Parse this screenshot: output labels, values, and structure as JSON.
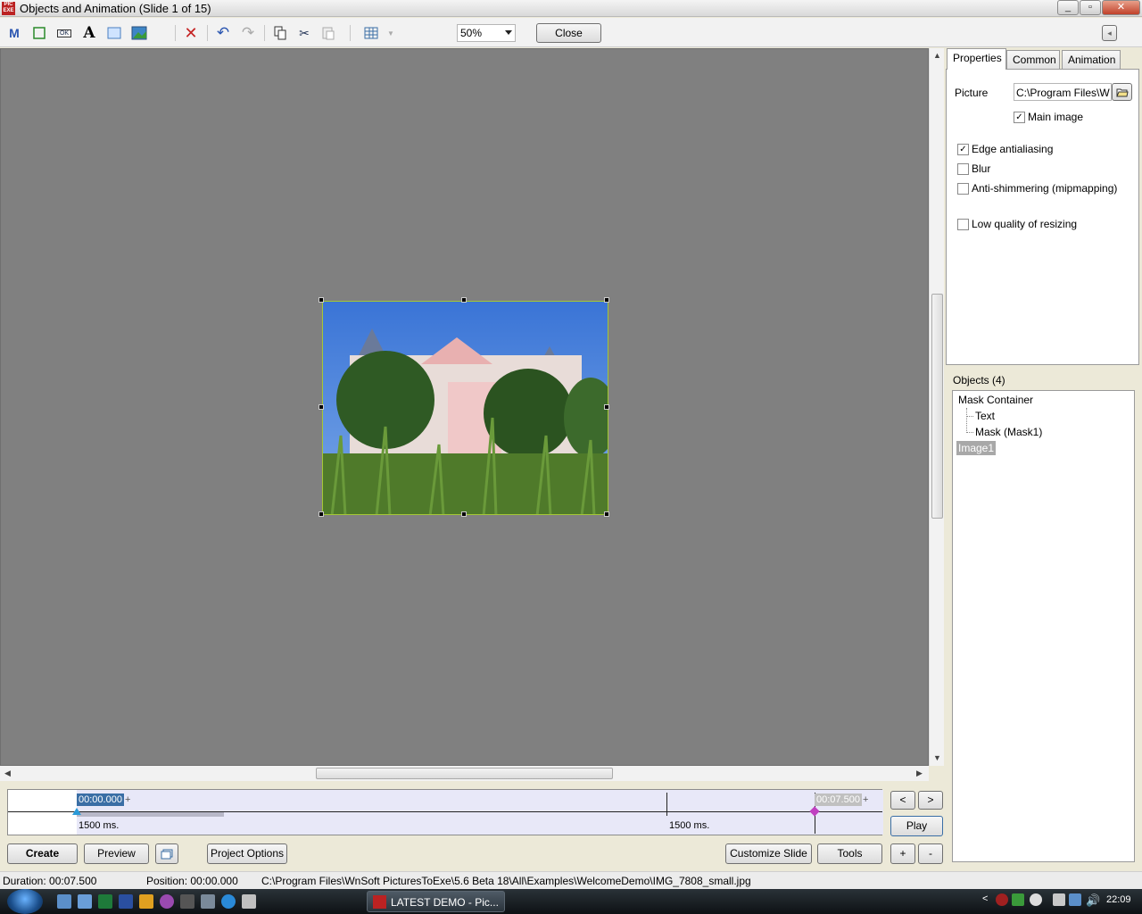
{
  "window": {
    "title": "Objects and Animation  (Slide 1 of 15)",
    "app_icon_text": "PIC EXE"
  },
  "toolbar": {
    "icons": [
      "mask-icon",
      "rectangle-icon",
      "button-icon",
      "text-icon",
      "frame-icon",
      "image-icon",
      "delete-icon",
      "undo-icon",
      "redo-icon",
      "copy-icon",
      "cut-icon",
      "paste-icon",
      "grid-icon"
    ],
    "mask_glyph": "M",
    "button_glyph": "OK",
    "text_glyph": "A",
    "zoom_value": "50%",
    "close_label": "Close",
    "collapse_glyph": "◂"
  },
  "tabs": [
    "Properties",
    "Common",
    "Animation"
  ],
  "properties": {
    "picture_label": "Picture",
    "picture_path": "C:\\Program Files\\W",
    "main_image": {
      "label": "Main image",
      "checked": true
    },
    "edge_antialiasing": {
      "label": "Edge antialiasing",
      "checked": true
    },
    "blur": {
      "label": "Blur",
      "checked": false
    },
    "anti_shimmering": {
      "label": "Anti-shimmering (mipmapping)",
      "checked": false
    },
    "low_quality": {
      "label": "Low quality of resizing",
      "checked": false
    }
  },
  "objects": {
    "header": "Objects (4)",
    "items": [
      {
        "label": "Mask Container",
        "level": 0
      },
      {
        "label": "Text",
        "level": 1
      },
      {
        "label": "Mask (Mask1)",
        "level": 1
      },
      {
        "label": "Image1",
        "level": 0,
        "selected": true
      }
    ]
  },
  "timeline": {
    "start_time": "00:00.000",
    "end_time": "00:07.500",
    "plus": "+",
    "left_duration": "1500 ms.",
    "right_duration": "1500 ms.",
    "prev_label": "<",
    "next_label": ">",
    "play_label": "Play"
  },
  "bottom_buttons": {
    "create": "Create",
    "preview": "Preview",
    "project_options": "Project Options",
    "customize_slide": "Customize Slide",
    "tools": "Tools",
    "add": "+",
    "remove": "-"
  },
  "status": {
    "duration": "Duration:  00:07.500",
    "position": "Position:  00:00.000",
    "file_path": "C:\\Program Files\\WnSoft PicturesToExe\\5.6 Beta 18\\All\\Examples\\WelcomeDemo\\IMG_7808_small.jpg"
  },
  "taskbar": {
    "active_window": "LATEST DEMO - Pic...",
    "clock": "22:09"
  },
  "colors": {
    "canvas": "#808080",
    "selection": "#3a6ea5",
    "timeline_fill": "#e8e8f8",
    "handle_border": "#a4c835"
  }
}
